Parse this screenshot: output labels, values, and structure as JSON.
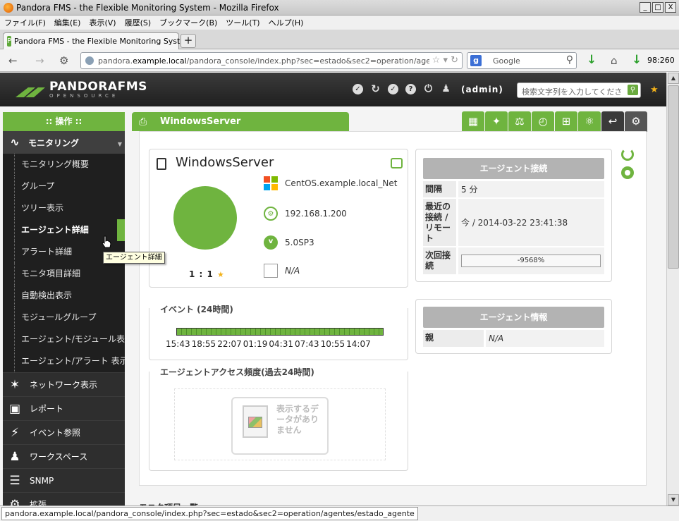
{
  "window": {
    "title": "Pandora FMS - the Flexible Monitoring System - Mozilla Firefox",
    "controls": [
      "_",
      "□",
      "X"
    ]
  },
  "menubar": [
    "ファイル(F)",
    "編集(E)",
    "表示(V)",
    "履歴(S)",
    "ブックマーク(B)",
    "ツール(T)",
    "ヘルプ(H)"
  ],
  "browser": {
    "tab_title": "Pandora FMS - the Flexible Monitoring System",
    "new_tab": "+",
    "url_host_prefix": "pandora.",
    "url_host_main": "example.local",
    "url_path": "/pandora_console/index.php?sec=estado&sec2=operation/agentes/ver",
    "search_placeholder": "Google",
    "download_counter": "98:260"
  },
  "header": {
    "logo_main": "PANDORAFMS",
    "logo_sub": "OPENSOURCE",
    "user": "(admin)",
    "search_placeholder": "検索文字列を入力してくださ"
  },
  "sidebar": {
    "heading": ":: 操作 ::",
    "monitoring": {
      "label": "モニタリング",
      "items": [
        "モニタリング概要",
        "グループ",
        "ツリー表示",
        "エージェント詳細",
        "アラート詳細",
        "モニタ項目詳細",
        "自動検出表示",
        "モジュールグループ",
        "エージェント/モジュール表示",
        "エージェント/アラート 表示"
      ],
      "active_index": 3
    },
    "sections": [
      {
        "label": "ネットワーク表示",
        "icon": "network-icon"
      },
      {
        "label": "レポート",
        "icon": "report-icon"
      },
      {
        "label": "イベント参照",
        "icon": "lightning-icon"
      },
      {
        "label": "ワークスペース",
        "icon": "user-icon"
      },
      {
        "label": "SNMP",
        "icon": "snmp-icon"
      },
      {
        "label": "拡張",
        "icon": "extensions-icon"
      }
    ]
  },
  "tooltip": "エージェント詳細",
  "page": {
    "title": "WindowsServer"
  },
  "agent": {
    "name": "WindowsServer",
    "os_name": "CentOS.example.local_Net",
    "ip": "192.168.1.200",
    "version": "5.0SP3",
    "description": "N/A",
    "ratio": "1 : 1",
    "ratio_star": "★",
    "version_icon_letter": "v"
  },
  "events": {
    "title": "イベント (24時間)",
    "ticks": [
      "15:43",
      "18:55",
      "22:07",
      "01:19",
      "04:31",
      "07:43",
      "10:55",
      "14:07"
    ]
  },
  "access": {
    "title": "エージェントアクセス頻度(過去24時間)",
    "no_data": "表示するデータがありません"
  },
  "connection": {
    "title": "エージェント接続",
    "rows": [
      {
        "key": "間隔",
        "value": "5 分"
      },
      {
        "key": "最近の接続 / リモート",
        "value": "今 / 2014-03-22 23:41:38"
      },
      {
        "key": "次回接続",
        "value": "-9568%"
      }
    ]
  },
  "info": {
    "title": "エージェント情報",
    "rows": [
      {
        "key": "親",
        "value": "N/A"
      }
    ]
  },
  "next_section": "モニタ項目一覧",
  "status_url": "pandora.example.local/pandora_console/index.php?sec=estado&sec2=operation/agentes/estado_agente",
  "colors": {
    "accent_green": "#6fb43f",
    "header_dark": "#2b2b2b",
    "table_head": "#b3b3b3"
  }
}
